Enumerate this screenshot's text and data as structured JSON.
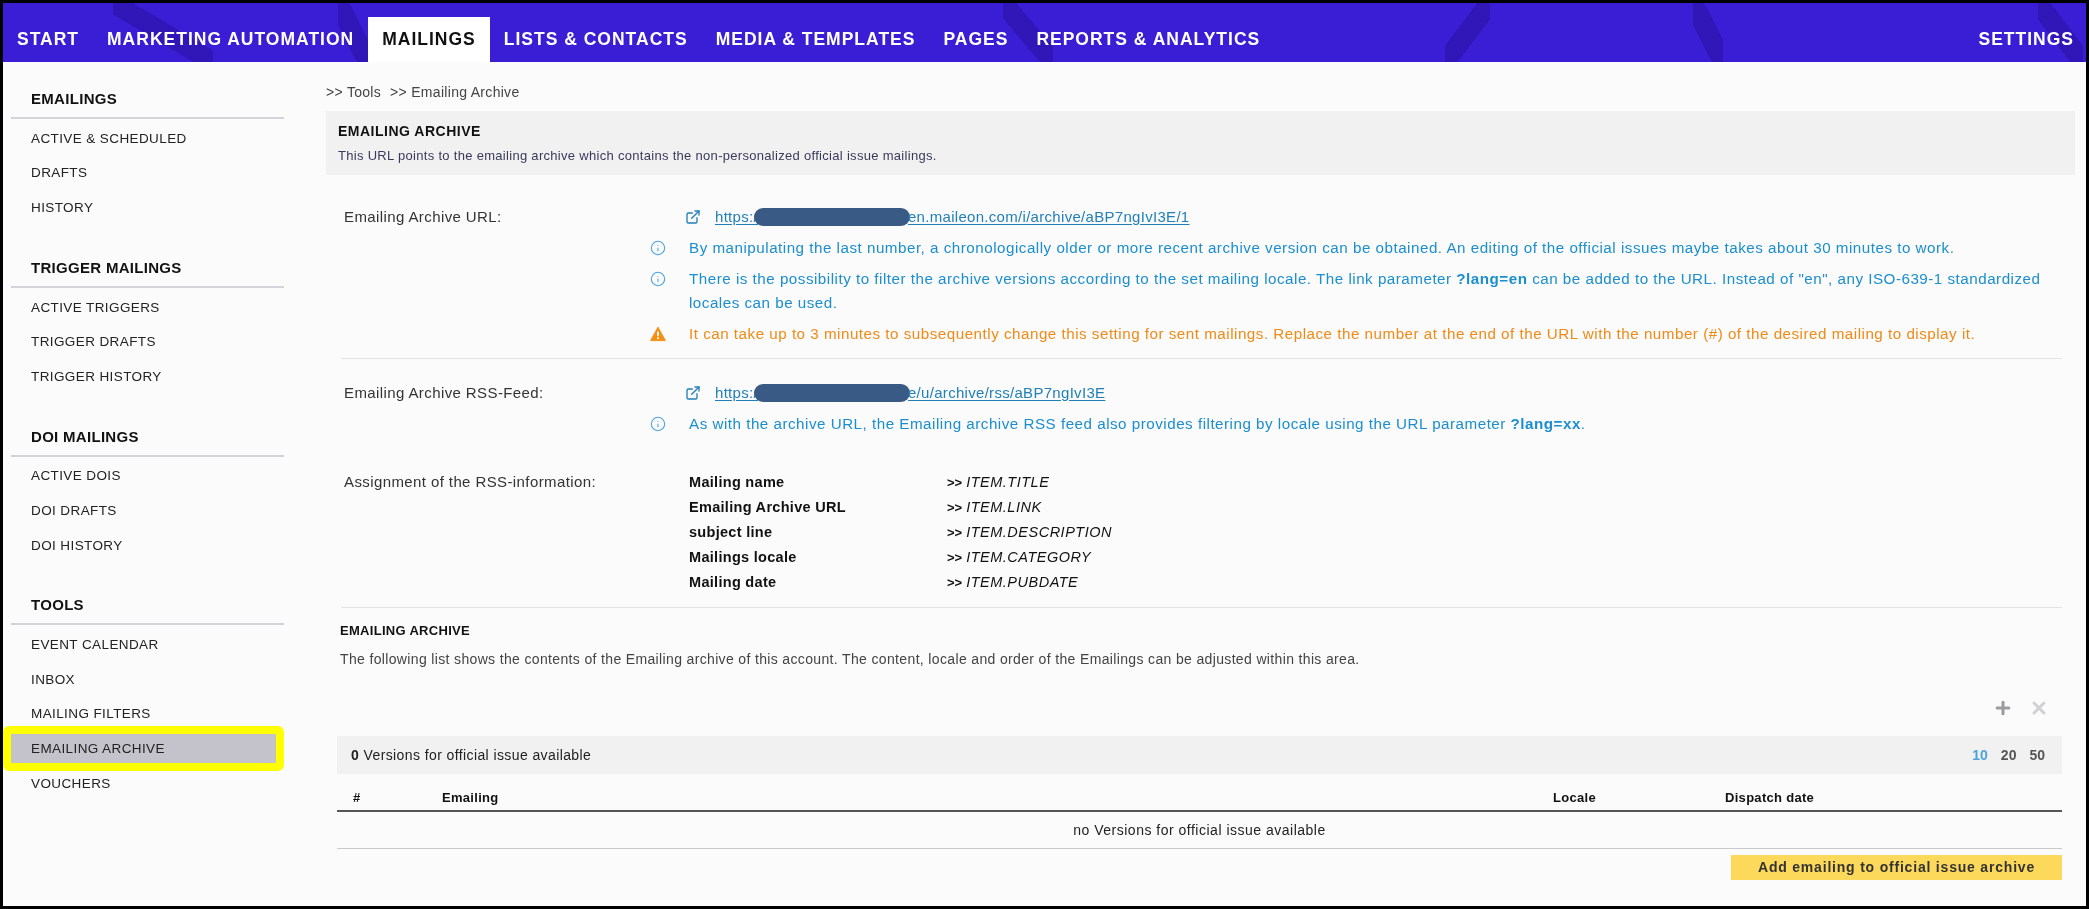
{
  "nav": {
    "tabs": [
      {
        "label": "START",
        "selected": false
      },
      {
        "label": "MARKETING AUTOMATION",
        "selected": false
      },
      {
        "label": "MAILINGS",
        "selected": true
      },
      {
        "label": "LISTS & CONTACTS",
        "selected": false
      },
      {
        "label": "MEDIA & TEMPLATES",
        "selected": false
      },
      {
        "label": "PAGES",
        "selected": false
      },
      {
        "label": "REPORTS & ANALYTICS",
        "selected": false
      }
    ],
    "settings": "SETTINGS"
  },
  "sidebar": {
    "sections": [
      {
        "title": "EMAILINGS",
        "items": [
          {
            "label": "ACTIVE & SCHEDULED",
            "selected": false,
            "highlighted": false
          },
          {
            "label": "DRAFTS",
            "selected": false,
            "highlighted": false
          },
          {
            "label": "HISTORY",
            "selected": false,
            "highlighted": false
          }
        ]
      },
      {
        "title": "TRIGGER MAILINGS",
        "items": [
          {
            "label": "ACTIVE TRIGGERS",
            "selected": false,
            "highlighted": false
          },
          {
            "label": "TRIGGER DRAFTS",
            "selected": false,
            "highlighted": false
          },
          {
            "label": "TRIGGER HISTORY",
            "selected": false,
            "highlighted": false
          }
        ]
      },
      {
        "title": "DOI MAILINGS",
        "items": [
          {
            "label": "ACTIVE DOIS",
            "selected": false,
            "highlighted": false
          },
          {
            "label": "DOI DRAFTS",
            "selected": false,
            "highlighted": false
          },
          {
            "label": "DOI HISTORY",
            "selected": false,
            "highlighted": false
          }
        ]
      },
      {
        "title": "TOOLS",
        "items": [
          {
            "label": "EVENT CALENDAR",
            "selected": false,
            "highlighted": false
          },
          {
            "label": "INBOX",
            "selected": false,
            "highlighted": false
          },
          {
            "label": "MAILING FILTERS",
            "selected": false,
            "highlighted": false
          },
          {
            "label": "EMAILING ARCHIVE",
            "selected": true,
            "highlighted": true
          },
          {
            "label": "VOUCHERS",
            "selected": false,
            "highlighted": false
          }
        ]
      }
    ]
  },
  "breadcrumb": [
    ">> Tools",
    ">> Emailing Archive"
  ],
  "header": {
    "title": "EMAILING ARCHIVE",
    "description": "This URL points to the emailing archive which contains the non-personalized official issue mailings."
  },
  "settings_rows": [
    {
      "kind": "link",
      "label": "Emailing Archive URL:",
      "link": {
        "prefix": "https:/",
        "redacted": true,
        "suffix": "en.maileon.com/i/archive/aBP7ngIvI3E/1"
      },
      "notes": [
        {
          "kind": "info",
          "text": "By manipulating the last number, a chronologically older or more recent archive version can be obtained. An editing of the official issues maybe takes about 30 minutes to work."
        },
        {
          "kind": "info",
          "text": "There is the possibility to filter the archive versions according to the set mailing locale. The link parameter **?lang=en** can be added to the URL. Instead of \"en\", any ISO-639-1 standardized locales can be used."
        },
        {
          "kind": "warning",
          "text": "It can take up to 3 minutes to subsequently change this setting for sent mailings. Replace the number at the end of the URL with the number (#) of the desired mailing to display it."
        }
      ],
      "divider": true
    },
    {
      "kind": "link",
      "label": "Emailing Archive RSS-Feed:",
      "link": {
        "prefix": "https:/",
        "redacted": true,
        "suffix": "e/u/archive/rss/aBP7ngIvI3E"
      },
      "notes": [
        {
          "kind": "info",
          "text": "As with the archive URL, the Emailing archive RSS feed also provides filtering by locale using the URL parameter **?lang=xx**."
        }
      ],
      "divider": false
    },
    {
      "kind": "mapping",
      "label": "Assignment of the RSS-information:",
      "mapping": [
        {
          "field": "Mailing name",
          "arrow": ">>",
          "value": "ITEM.TITLE"
        },
        {
          "field": "Emailing Archive URL",
          "arrow": ">>",
          "value": "ITEM.LINK"
        },
        {
          "field": "subject line",
          "arrow": ">>",
          "value": "ITEM.DESCRIPTION"
        },
        {
          "field": "Mailings locale",
          "arrow": ">>",
          "value": "ITEM.CATEGORY"
        },
        {
          "field": "Mailing date",
          "arrow": ">>",
          "value": "ITEM.PUBDATE"
        }
      ],
      "divider": true
    }
  ],
  "archive": {
    "title": "EMAILING ARCHIVE",
    "description": "The following list shows the contents of the Emailing archive of this account. The content, locale and order of the Emailings can be adjusted within this area.",
    "actions": [
      {
        "kind": "add",
        "disabled": false
      },
      {
        "kind": "remove",
        "disabled": true
      }
    ],
    "summary": "**0** Versions for official issue available",
    "page_sizes": [
      {
        "label": "10",
        "selected": true
      },
      {
        "label": "20",
        "selected": false
      },
      {
        "label": "50",
        "selected": false
      }
    ],
    "columns": [
      "#",
      "Emailing",
      "Locale",
      "Dispatch date"
    ],
    "empty_message": "no Versions for official issue available",
    "button": "Add emailing to official issue archive"
  }
}
